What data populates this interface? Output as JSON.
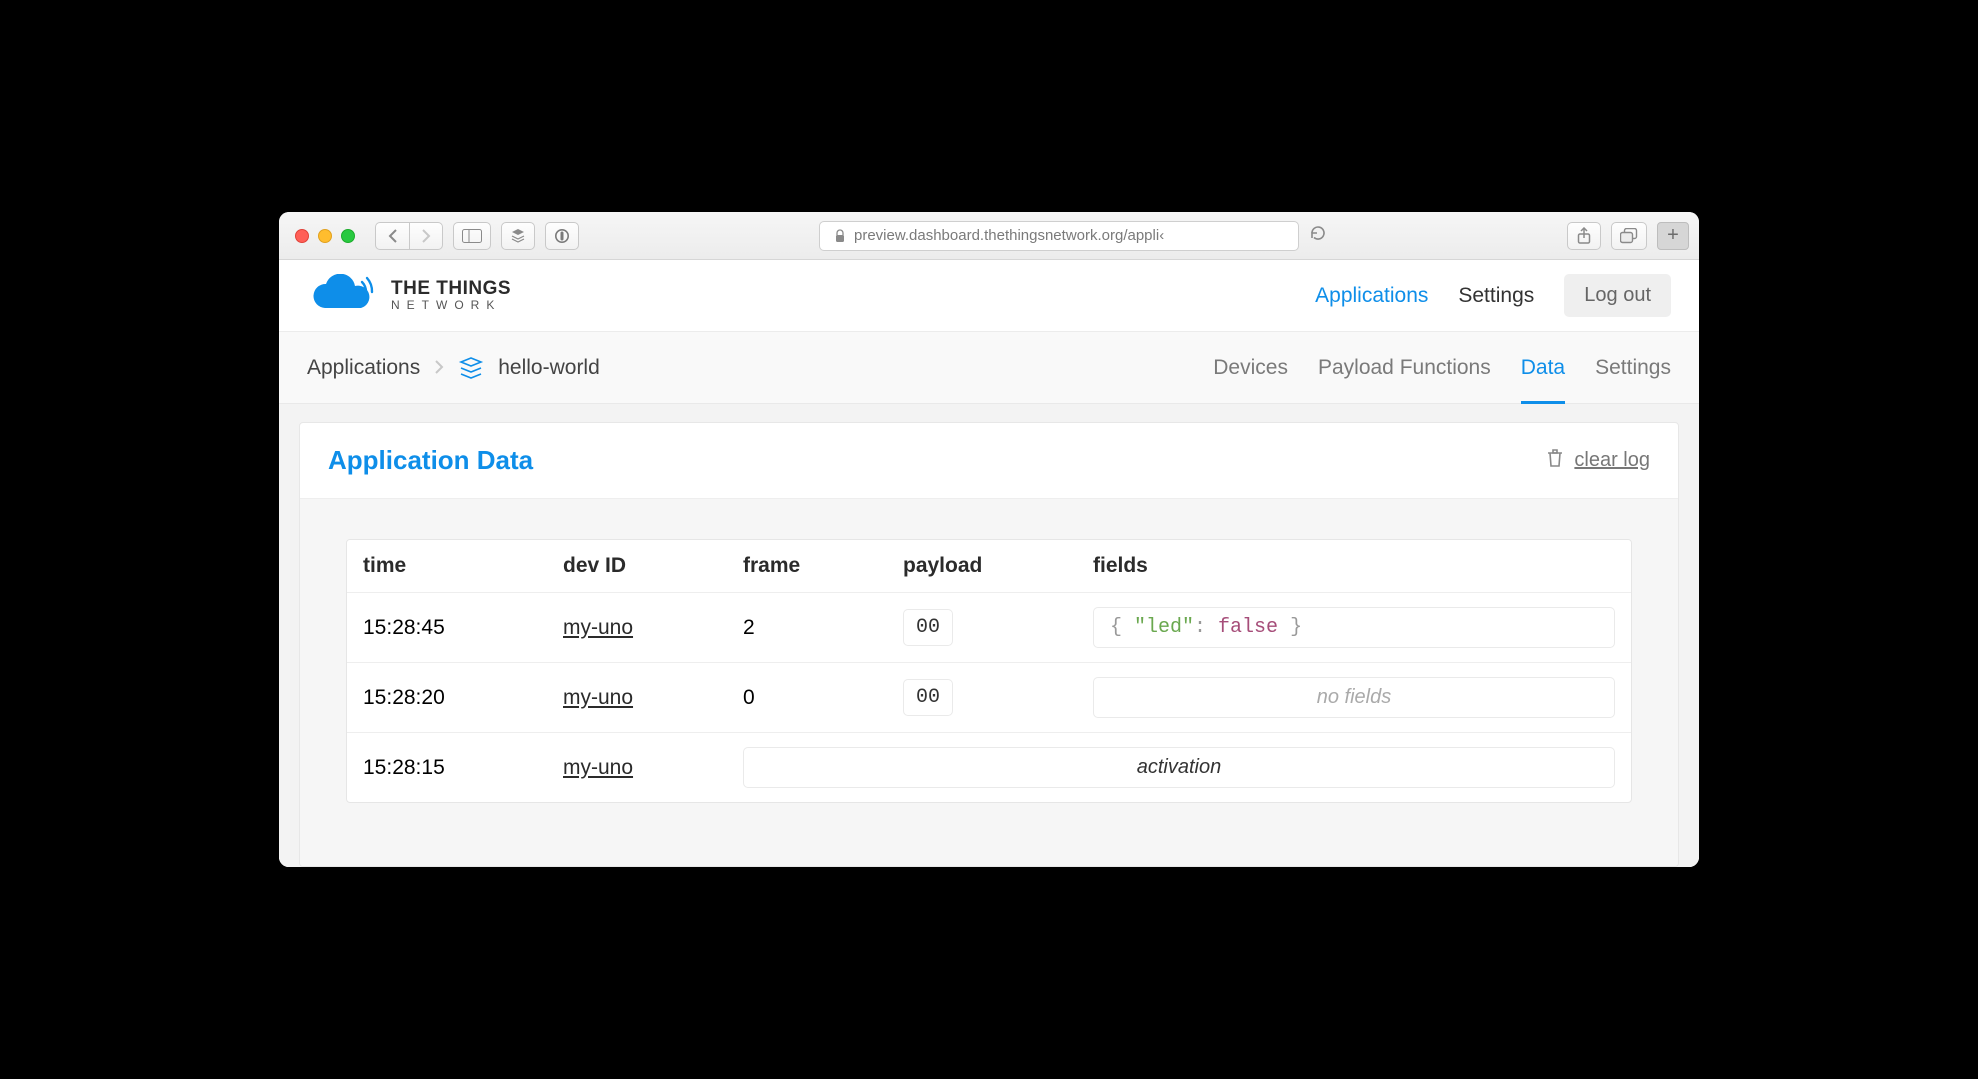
{
  "browser": {
    "url": "preview.dashboard.thethingsnetwork.org/appli‹"
  },
  "brand": {
    "line1": "THE THINGS",
    "line2": "NETWORK"
  },
  "topnav": {
    "applications": "Applications",
    "settings": "Settings",
    "logout": "Log out"
  },
  "breadcrumb": {
    "root": "Applications",
    "app": "hello-world"
  },
  "subtabs": {
    "devices": "Devices",
    "payload": "Payload Functions",
    "data": "Data",
    "settings": "Settings"
  },
  "panel": {
    "title": "Application Data",
    "clear_log": "clear log"
  },
  "table": {
    "headers": {
      "time": "time",
      "dev_id": "dev ID",
      "frame": "frame",
      "payload": "payload",
      "fields": "fields"
    },
    "rows": [
      {
        "time": "15:28:45",
        "dev_id": "my-uno",
        "frame": "2",
        "payload": "00",
        "fields": {
          "type": "json",
          "key": "\"led\"",
          "sep": ": ",
          "value": "false"
        }
      },
      {
        "time": "15:28:20",
        "dev_id": "my-uno",
        "frame": "0",
        "payload": "00",
        "fields": {
          "type": "none",
          "text": "no fields"
        }
      },
      {
        "time": "15:28:15",
        "dev_id": "my-uno",
        "frame": "",
        "payload": "",
        "fields": {
          "type": "activation",
          "text": "activation"
        }
      }
    ]
  }
}
